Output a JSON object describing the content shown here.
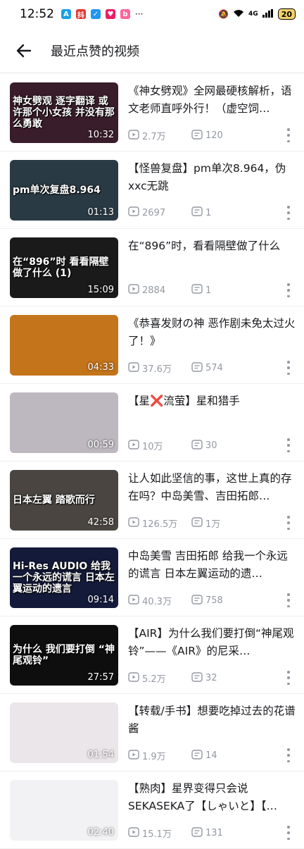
{
  "status_bar": {
    "time": "12:52",
    "network": "4G",
    "battery": "20"
  },
  "header": {
    "title": "最近点赞的视频"
  },
  "videos": [
    {
      "thumb_text": "神女劈观 逐字翻译 或许那个小女孩 并没有那么勇敢",
      "duration": "10:32",
      "title": "《神女劈观》全网最硬核解析，语文老师直呼外行！（虚空饲…",
      "views": "2.7万",
      "comments": "120",
      "thumb_bg": "#3a1d2a"
    },
    {
      "thumb_text": "pm单次复盘8.964",
      "duration": "01:13",
      "title": "【怪兽复盘】pm单次8.964，伪xxc无跳",
      "views": "2697",
      "comments": "1",
      "thumb_bg": "#2a3a44"
    },
    {
      "thumb_text": "在“896”时 看看隔壁做了什么 (1)",
      "duration": "15:09",
      "title": "在“896”时，看看隔壁做了什么",
      "views": "2884",
      "comments": "1",
      "thumb_bg": "#1a1a1a"
    },
    {
      "thumb_text": "",
      "duration": "04:33",
      "title": "《恭喜发财の神 恶作剧未免太过火了！》",
      "views": "37.6万",
      "comments": "574",
      "thumb_bg": "#c4741a"
    },
    {
      "thumb_text": "",
      "duration": "00:59",
      "title": "【星❌流萤】星和猎手",
      "views": "10万",
      "comments": "30",
      "thumb_bg": "#bdb8bf"
    },
    {
      "thumb_text": "日本左翼 踏歌而行",
      "duration": "42:58",
      "title": "让人如此坚信的事，这世上真的存在吗？中岛美雪、吉田拓郎…",
      "views": "126.5万",
      "comments": "1万",
      "thumb_bg": "#4a4540"
    },
    {
      "thumb_text": "Hi-Res AUDIO 给我一个永远的谎言 日本左翼运动的遗言",
      "duration": "09:14",
      "title": "中岛美雪 吉田拓郎 给我一个永远的谎言 日本左翼运动的遗…",
      "views": "40.3万",
      "comments": "758",
      "thumb_bg": "#141a3a"
    },
    {
      "thumb_text": "为什么 我们要打倒 “神尾观铃”",
      "duration": "27:57",
      "title": "【AIR】为什么我们要打倒“神尾观铃”——《AIR》的尼采…",
      "views": "5.2万",
      "comments": "32",
      "thumb_bg": "#0e0e0e"
    },
    {
      "thumb_text": "",
      "duration": "01:54",
      "title": "【转载/手书】想要吃掉过去的花谱酱",
      "views": "1.9万",
      "comments": "14",
      "thumb_bg": "#eae6ea"
    },
    {
      "thumb_text": "",
      "duration": "02:40",
      "title": "【熟肉】星界变得只会说SEKASEKA了【しゃいと】【…",
      "views": "15.1万",
      "comments": "131",
      "thumb_bg": "#f2f2f4"
    }
  ]
}
